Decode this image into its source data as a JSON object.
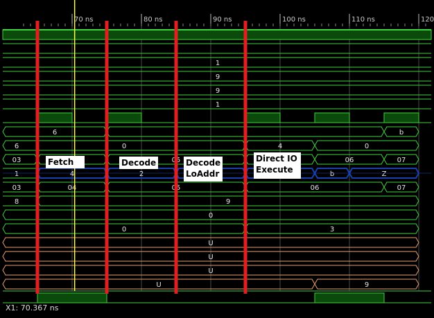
{
  "colors": {
    "background": "#000000",
    "signal": "#3fd33f",
    "bus_fill": "#0a4a0a",
    "bus_blue": "#1a3fb0",
    "orange_signal": "#e8a070",
    "grid": "#4a4a4a",
    "cursor": "#ffff33",
    "marker": "#e02020",
    "text": "#e6e6e6"
  },
  "timeline": {
    "ticks": [
      {
        "t": 70,
        "label": "70 ns"
      },
      {
        "t": 80,
        "label": "80 ns"
      },
      {
        "t": 90,
        "label": "90 ns"
      },
      {
        "t": 100,
        "label": "100 ns"
      },
      {
        "t": 110,
        "label": "110 ns"
      },
      {
        "t": 120,
        "label": "120"
      }
    ]
  },
  "cursor": {
    "time_ns": 70.367,
    "readout": "X1: 70.367 ns"
  },
  "markers_ns": [
    65,
    75,
    85,
    95
  ],
  "annotations": {
    "fetch": "Fetch",
    "decode": "Decode",
    "decode_loaddr_1": "Decode",
    "decode_loaddr_2": "LoAddr",
    "direct_io_1": "Direct IO",
    "direct_io_2": "Execute"
  },
  "rows": [
    {
      "type": "clock",
      "edges": [],
      "note": "top solid bar"
    },
    {
      "type": "const",
      "label": "",
      "value_label": ""
    },
    {
      "type": "const",
      "value_label": "1"
    },
    {
      "type": "const",
      "value_label": "9"
    },
    {
      "type": "const",
      "value_label": "9"
    },
    {
      "type": "const",
      "value_label": "1"
    },
    {
      "type": "pulse",
      "highs": [
        [
          65,
          70
        ],
        [
          75,
          80
        ],
        [
          95,
          100
        ],
        [
          105,
          110
        ],
        [
          115,
          120
        ]
      ]
    },
    {
      "type": "bus",
      "segments": [
        {
          "from": 60,
          "to": 75,
          "label": "6"
        },
        {
          "from": 75,
          "to": 115,
          "label": ""
        },
        {
          "from": 115,
          "to": 120,
          "label": "b"
        }
      ]
    },
    {
      "type": "bus",
      "left_label": "6",
      "segments": [
        {
          "from": 60,
          "to": 95,
          "label": "0"
        },
        {
          "from": 95,
          "to": 105,
          "label": "4"
        },
        {
          "from": 105,
          "to": 120,
          "label": "0"
        }
      ]
    },
    {
      "type": "bus",
      "left_label": "03",
      "segments": [
        {
          "from": 60,
          "to": 65,
          "label": ""
        },
        {
          "from": 65,
          "to": 75,
          "label": "04"
        },
        {
          "from": 75,
          "to": 95,
          "label": "05"
        },
        {
          "from": 95,
          "to": 105,
          "label": "03"
        },
        {
          "from": 105,
          "to": 115,
          "label": "06"
        },
        {
          "from": 115,
          "to": 120,
          "label": "07"
        }
      ]
    },
    {
      "type": "bus_blue",
      "left_label": "1",
      "segments": [
        {
          "from": 65,
          "to": 75,
          "label": "4"
        },
        {
          "from": 75,
          "to": 85,
          "label": "2"
        },
        {
          "from": 85,
          "to": 95,
          "label": "3"
        },
        {
          "from": 95,
          "to": 105,
          "label": "Z"
        },
        {
          "from": 105,
          "to": 110,
          "label": "b"
        },
        {
          "from": 110,
          "to": 120,
          "label": "Z"
        }
      ]
    },
    {
      "type": "bus",
      "left_label": "03",
      "segments": [
        {
          "from": 65,
          "to": 75,
          "label": "04"
        },
        {
          "from": 75,
          "to": 95,
          "label": "05"
        },
        {
          "from": 95,
          "to": 115,
          "label": "06"
        },
        {
          "from": 115,
          "to": 120,
          "label": "07"
        }
      ]
    },
    {
      "type": "bus",
      "left_label": "8",
      "segments": [
        {
          "from": 65,
          "to": 120,
          "label": "9"
        }
      ]
    },
    {
      "type": "bus",
      "segments": [
        {
          "from": 60,
          "to": 120,
          "label": "0"
        }
      ]
    },
    {
      "type": "bus",
      "segments": [
        {
          "from": 60,
          "to": 95,
          "label": "0"
        },
        {
          "from": 95,
          "to": 120,
          "label": "3"
        }
      ]
    },
    {
      "type": "orange_bus",
      "segments": [
        {
          "from": 60,
          "to": 120,
          "label": "U"
        }
      ]
    },
    {
      "type": "orange_bus",
      "segments": [
        {
          "from": 60,
          "to": 120,
          "label": "U"
        }
      ]
    },
    {
      "type": "orange_bus",
      "segments": [
        {
          "from": 60,
          "to": 120,
          "label": "U"
        }
      ]
    },
    {
      "type": "orange_bus",
      "segments": [
        {
          "from": 60,
          "to": 105,
          "label": "U"
        },
        {
          "from": 105,
          "to": 120,
          "label": "9"
        }
      ]
    },
    {
      "type": "pulse",
      "highs": [
        [
          65,
          75
        ],
        [
          105,
          115
        ]
      ]
    }
  ]
}
